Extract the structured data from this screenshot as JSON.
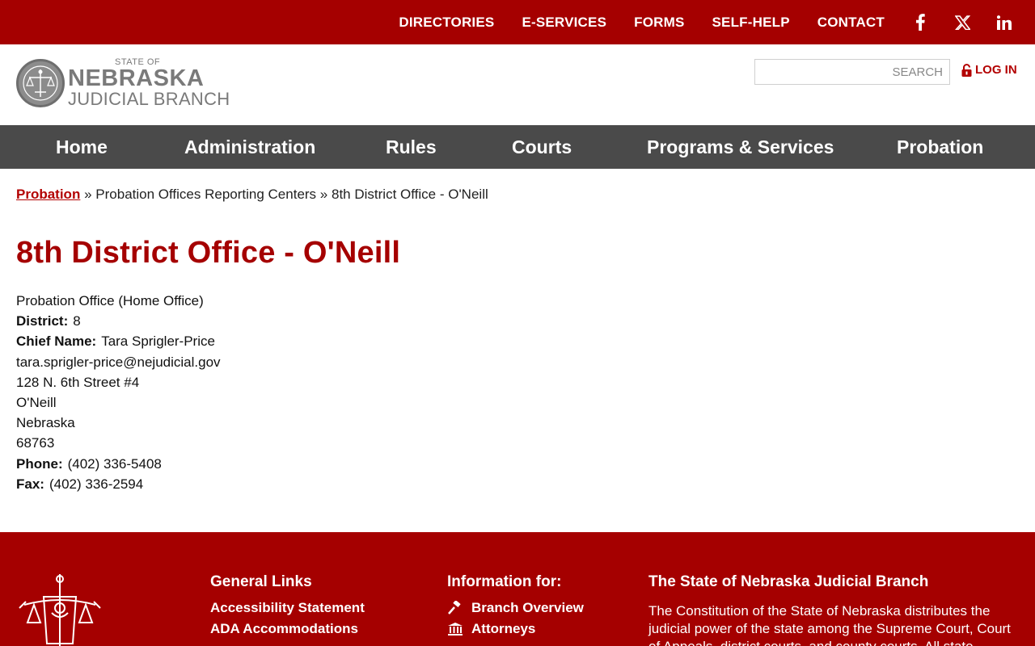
{
  "top_nav": {
    "items": [
      "DIRECTORIES",
      "E-SERVICES",
      "FORMS",
      "SELF-HELP",
      "CONTACT"
    ],
    "social": [
      "facebook-icon",
      "x-twitter-icon",
      "linkedin-icon"
    ]
  },
  "header": {
    "logo_line1": "STATE OF",
    "logo_line2": "NEBRASKA",
    "logo_line3": "JUDICIAL BRANCH",
    "search_placeholder": "SEARCH",
    "login_label": "LOG IN"
  },
  "main_nav": [
    "Home",
    "Administration",
    "Rules",
    "Courts",
    "Programs & Services",
    "Probation"
  ],
  "breadcrumb": {
    "link": "Probation",
    "sep": "»",
    "item2": "Probation Offices Reporting Centers",
    "item3": "8th District Office - O'Neill"
  },
  "page": {
    "title": "8th District Office - O'Neill",
    "office_type": "Probation Office (Home Office)",
    "district_label": "District:",
    "district_value": "8",
    "chief_label": "Chief Name:",
    "chief_value": "Tara Sprigler-Price",
    "email": "tara.sprigler-price@nejudicial.gov",
    "street": "128 N. 6th Street #4",
    "city": "O'Neill",
    "state": "Nebraska",
    "zip": "68763",
    "phone_label": "Phone:",
    "phone_value": "(402) 336-5408",
    "fax_label": "Fax:",
    "fax_value": "(402) 336-2594"
  },
  "footer": {
    "general_heading": "General Links",
    "general_links": [
      "Accessibility Statement",
      "ADA Accommodations"
    ],
    "info_heading": "Information for:",
    "info_links": [
      "Branch Overview",
      "Attorneys"
    ],
    "about_heading": "The State of Nebraska Judicial Branch",
    "about_text": "The Constitution of the State of Nebraska distributes the judicial power of the state among the Supreme Court, Court of Appeals, district courts, and county courts. All state"
  },
  "colors": {
    "brand_red": "#a50000",
    "nav_gray": "#4a4a4a"
  }
}
